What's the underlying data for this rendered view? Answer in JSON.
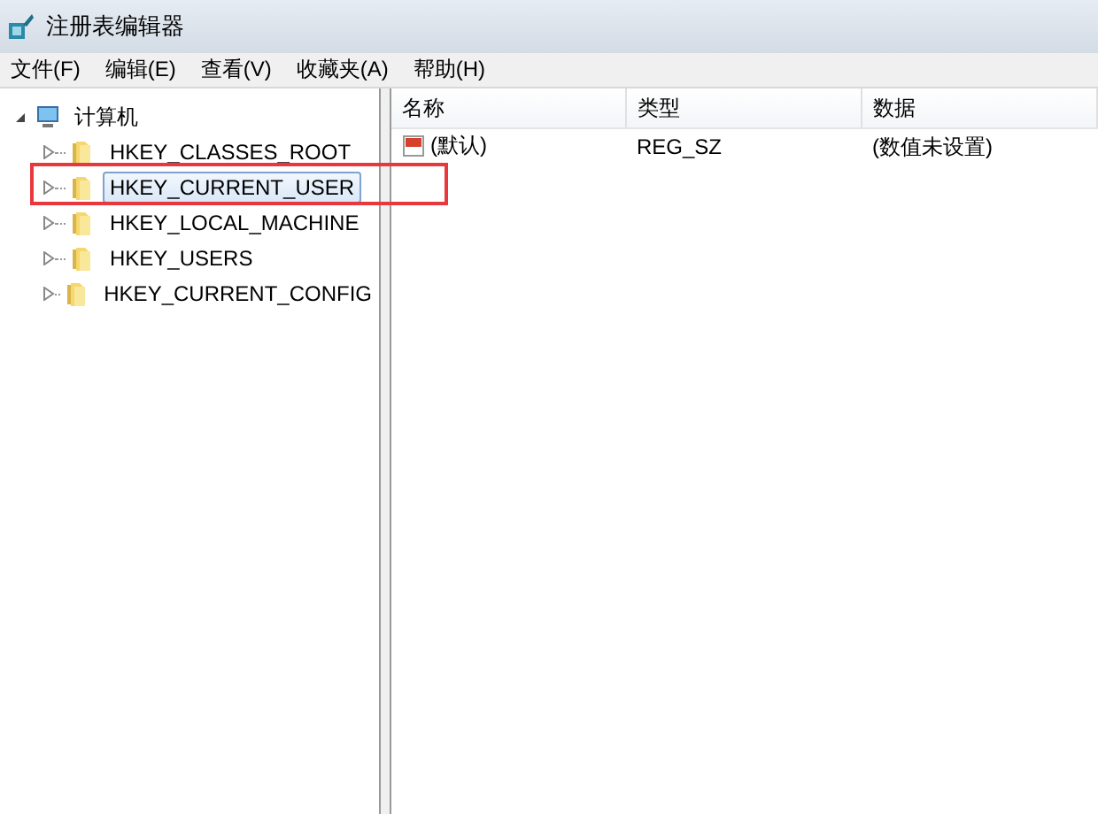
{
  "window": {
    "title": "注册表编辑器"
  },
  "menu": [
    "文件(F)",
    "编辑(E)",
    "查看(V)",
    "收藏夹(A)",
    "帮助(H)"
  ],
  "tree": {
    "label": "计算机",
    "expanded": true,
    "children": [
      {
        "label": "HKEY_CLASSES_ROOT",
        "selected": false,
        "highlighted": false
      },
      {
        "label": "HKEY_CURRENT_USER",
        "selected": true,
        "highlighted": true
      },
      {
        "label": "HKEY_LOCAL_MACHINE",
        "selected": false,
        "highlighted": false
      },
      {
        "label": "HKEY_USERS",
        "selected": false,
        "highlighted": false
      },
      {
        "label": "HKEY_CURRENT_CONFIG",
        "selected": false,
        "highlighted": false
      }
    ]
  },
  "table": {
    "columns": [
      "名称",
      "类型",
      "数据"
    ],
    "rows": [
      [
        "(默认)",
        "REG_SZ",
        "(数值未设置)"
      ]
    ]
  }
}
